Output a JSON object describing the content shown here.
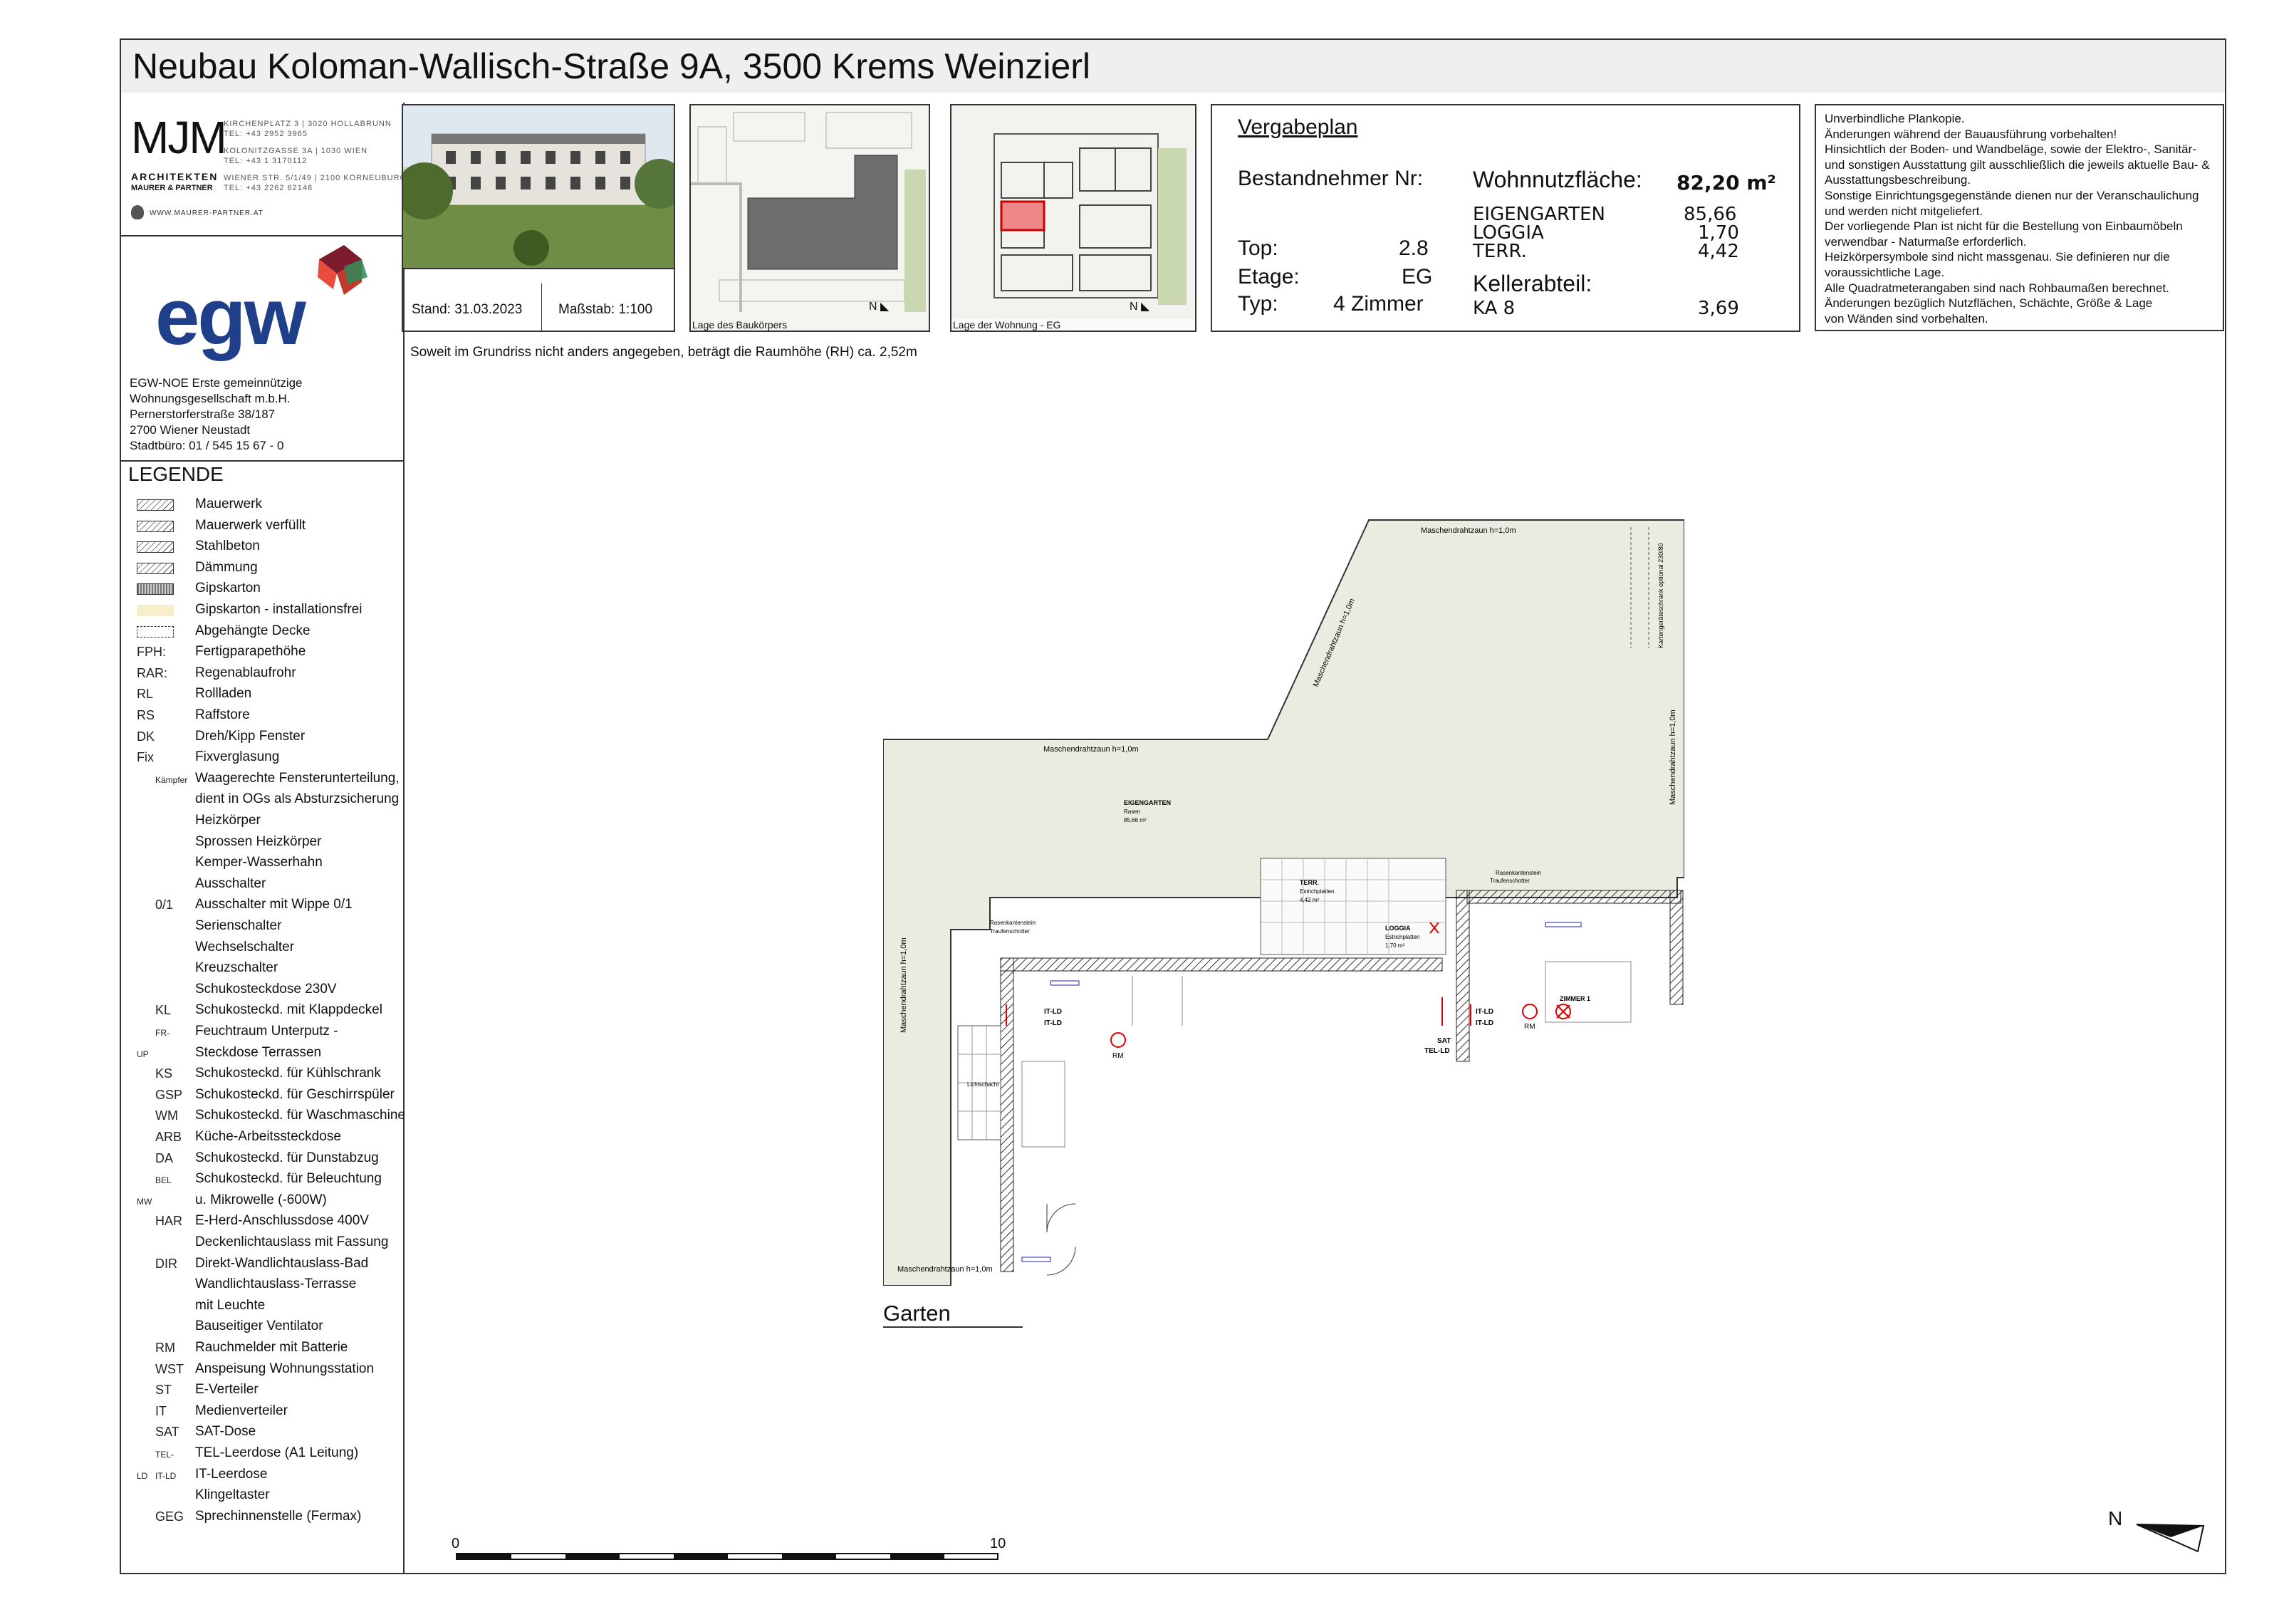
{
  "title": {
    "prefix": "Neubau ",
    "main": "Koloman-Wallisch-Straße 9A, 3500 Krems Weinzierl"
  },
  "architect": {
    "logo": "MJM",
    "sub1": "ARCHITEKTEN",
    "sub2": "MAURER & PARTNER",
    "addr1": "KIRCHENPLATZ 3 | 3020  HOLLABRUNN",
    "tel1": "TEL: +43 2952 3965",
    "addr2": "KOLONITZGASSE 3A | 1030      WIEN",
    "tel2": "TEL: +43 1 3170112",
    "addr3": "WIENER STR. 5/1/49 | 2100  KORNEUBURG",
    "tel3": "TEL: +43 2262 62148",
    "web": "WWW.MAURER-PARTNER.AT"
  },
  "client": {
    "logo": "egw",
    "lines": [
      "EGW-NOE Erste gemeinnützige",
      "Wohnungsgesellschaft m.b.H.",
      "Pernerstorferstraße 38/187",
      "2700 Wiener Neustadt",
      "Stadtbüro: 01 / 545 15 67 - 0"
    ]
  },
  "stand": "Stand: 31.03.2023",
  "massstab": "Maßstab:  1:100",
  "lage_bau": "Lage des Baukörpers",
  "lage_wohnung": "Lage der Wohnung - EG",
  "info": {
    "heading": "Vergabeplan",
    "bestand_label": "Bestandnehmer Nr:",
    "wnf_label": "Wohnnutzfläche:",
    "wnf_value": "82,20 m²",
    "eigengarten_label": "EIGENGARTEN",
    "eigengarten_value": "85,66",
    "loggia_label": "LOGGIA",
    "loggia_value": "1,70",
    "terr_label": "TERR.",
    "terr_value": "4,42",
    "top_label": "Top:",
    "top_value": "2.8",
    "etage_label": "Etage:",
    "etage_value": "EG",
    "typ_label": "Typ:",
    "typ_value": "4 Zimmer",
    "keller_label": "Kellerabteil:",
    "ka_label": "KA 8",
    "ka_value": "3,69"
  },
  "notes": [
    "Unverbindliche Plankopie.",
    "Änderungen während der Bauausführung vorbehalten!",
    "Hinsichtlich der Boden- und Wandbeläge, sowie der Elektro-, Sanitär-",
    "und sonstigen Ausstattung gilt ausschließlich die jeweils aktuelle Bau- &",
    "Ausstattungsbeschreibung.",
    "Sonstige Einrichtungsgegenstände dienen nur der Veranschaulichung",
    "und werden nicht mitgeliefert.",
    "Der vorliegende Plan ist nicht für die Bestellung von Einbaumöbeln",
    "verwendbar - Naturmaße erforderlich.",
    "Heizkörpersymbole sind nicht massgenau. Sie definieren nur die",
    "voraussichtliche Lage.",
    "Alle Quadratmeterangaben sind nach Rohbaumaßen berechnet.",
    "Änderungen bezüglich Nutzflächen, Schächte, Größe & Lage",
    "von Wänden sind vorbehalten."
  ],
  "raumhoehe": "Soweit im Grundriss nicht anders angegeben, beträgt die Raumhöhe (RH) ca. 2,52m",
  "legend": {
    "heading": "LEGENDE",
    "items": [
      {
        "sym": "",
        "label": "Mauerwerk"
      },
      {
        "sym": "",
        "label": "Mauerwerk verfüllt"
      },
      {
        "sym": "",
        "label": "Stahlbeton"
      },
      {
        "sym": "",
        "label": "Dämmung"
      },
      {
        "sym": "",
        "label": "Gipskarton"
      },
      {
        "sym": "",
        "label": "Gipskarton - installationsfrei"
      },
      {
        "sym": "",
        "label": "Abgehängte Decke"
      },
      {
        "sym": "FPH:",
        "label": "Fertigparapethöhe"
      },
      {
        "sym": "RAR:",
        "label": "Regenablaufrohr"
      },
      {
        "sym": "RL",
        "label": "Rollladen"
      },
      {
        "sym": "RS",
        "label": "Raffstore"
      },
      {
        "sym": "DK",
        "label": "Dreh/Kipp Fenster"
      },
      {
        "sym": "Fix",
        "label": "Fixverglasung"
      },
      {
        "sym": "Kämpfer",
        "label": "Waagerechte Fensterunterteilung,"
      },
      {
        "sym": "",
        "label": "dient in OGs als Absturzsicherung"
      },
      {
        "sym": "",
        "label": "Heizkörper"
      },
      {
        "sym": "",
        "label": "Sprossen Heizkörper"
      },
      {
        "sym": "",
        "label": "Kemper-Wasserhahn"
      },
      {
        "sym": "",
        "label": "Ausschalter"
      },
      {
        "sym": "0/1",
        "label": "Ausschalter mit Wippe 0/1"
      },
      {
        "sym": "",
        "label": "Serienschalter"
      },
      {
        "sym": "",
        "label": "Wechselschalter"
      },
      {
        "sym": "",
        "label": "Kreuzschalter"
      },
      {
        "sym": "",
        "label": "Schukosteckdose 230V"
      },
      {
        "sym": "KL",
        "label": "Schukosteckd. mit Klappdeckel"
      },
      {
        "sym": "FR-UP",
        "label": "Feuchtraum Unterputz -"
      },
      {
        "sym": "",
        "label": "Steckdose Terrassen"
      },
      {
        "sym": "KS",
        "label": "Schukosteckd. für Kühlschrank"
      },
      {
        "sym": "GSP",
        "label": "Schukosteckd. für Geschirrspüler"
      },
      {
        "sym": "WM",
        "label": "Schukosteckd. für Waschmaschine"
      },
      {
        "sym": "ARB",
        "label": "Küche-Arbeitssteckdose"
      },
      {
        "sym": "DA",
        "label": "Schukosteckd. für Dunstabzug"
      },
      {
        "sym": "BEL MW",
        "label": "Schukosteckd. für Beleuchtung"
      },
      {
        "sym": "",
        "label": "u. Mikrowelle (-600W)"
      },
      {
        "sym": "HAR",
        "label": "E-Herd-Anschlussdose 400V"
      },
      {
        "sym": "",
        "label": "Deckenlichtauslass mit Fassung"
      },
      {
        "sym": "DIR",
        "label": "Direkt-Wandlichtauslass-Bad"
      },
      {
        "sym": "",
        "label": "Wandlichtauslass-Terrasse"
      },
      {
        "sym": "",
        "label": "mit Leuchte"
      },
      {
        "sym": "",
        "label": "Bauseitiger Ventilator"
      },
      {
        "sym": "RM",
        "label": "Rauchmelder mit Batterie"
      },
      {
        "sym": "WST",
        "label": "Anspeisung Wohnungsstation"
      },
      {
        "sym": "ST",
        "label": "E-Verteiler"
      },
      {
        "sym": "IT",
        "label": "Medienverteiler"
      },
      {
        "sym": "SAT",
        "label": "SAT-Dose"
      },
      {
        "sym": "TEL-LD",
        "label": "TEL-Leerdose (A1 Leitung)"
      },
      {
        "sym": "IT-LD",
        "label": "IT-Leerdose"
      },
      {
        "sym": "",
        "label": "Klingeltaster"
      },
      {
        "sym": "GEG",
        "label": "Sprechinnenstelle (Fermax)"
      }
    ]
  },
  "plan": {
    "fence_top": "Maschendrahtzaun h=1,0m",
    "fence_diag": "Maschendrahtzaun h=1,0m",
    "fence_mid": "Maschendrahtzaun h=1,0m",
    "fence_right": "Maschendrahtzaun h=1,0m",
    "fence_left": "Maschendrahtzaun h=1,0m",
    "fence_bottom": "Maschendrahtzaun h=1,0m",
    "kartenger": "Kartengeräteschrank optional 230/80",
    "eigengarten": "EIGENGARTEN",
    "rasen": "Rasen",
    "eig_area": "85,66 m²",
    "terr": "TERR.",
    "terr_sub": "Estrichplatten",
    "terr_area": "4,42 m²",
    "loggia": "LOGGIA",
    "loggia_sub": "Estrichplatten",
    "loggia_area": "1,70 m²",
    "zimmer": "ZIMMER 1",
    "lichtschacht": "Lichtschacht",
    "rasenkante": "Rasenkantenstein",
    "traufe": "Traufenschotter",
    "garten": "Garten",
    "rm": "RM",
    "itld": "IT-LD",
    "sat": "SAT",
    "telld": "TEL-LD"
  },
  "scale": {
    "start": "0",
    "end": "10"
  },
  "north": "N"
}
